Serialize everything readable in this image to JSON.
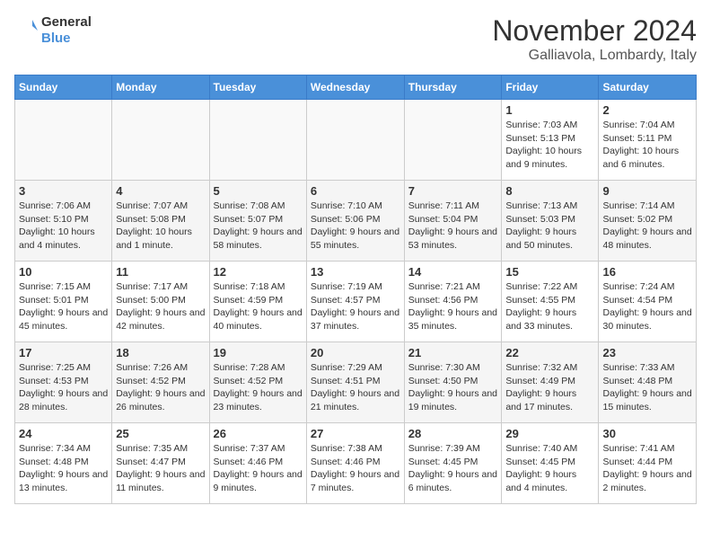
{
  "header": {
    "logo_line1": "General",
    "logo_line2": "Blue",
    "month_year": "November 2024",
    "location": "Galliavola, Lombardy, Italy"
  },
  "weekdays": [
    "Sunday",
    "Monday",
    "Tuesday",
    "Wednesday",
    "Thursday",
    "Friday",
    "Saturday"
  ],
  "weeks": [
    [
      {
        "day": "",
        "info": ""
      },
      {
        "day": "",
        "info": ""
      },
      {
        "day": "",
        "info": ""
      },
      {
        "day": "",
        "info": ""
      },
      {
        "day": "",
        "info": ""
      },
      {
        "day": "1",
        "info": "Sunrise: 7:03 AM\nSunset: 5:13 PM\nDaylight: 10 hours and 9 minutes."
      },
      {
        "day": "2",
        "info": "Sunrise: 7:04 AM\nSunset: 5:11 PM\nDaylight: 10 hours and 6 minutes."
      }
    ],
    [
      {
        "day": "3",
        "info": "Sunrise: 7:06 AM\nSunset: 5:10 PM\nDaylight: 10 hours and 4 minutes."
      },
      {
        "day": "4",
        "info": "Sunrise: 7:07 AM\nSunset: 5:08 PM\nDaylight: 10 hours and 1 minute."
      },
      {
        "day": "5",
        "info": "Sunrise: 7:08 AM\nSunset: 5:07 PM\nDaylight: 9 hours and 58 minutes."
      },
      {
        "day": "6",
        "info": "Sunrise: 7:10 AM\nSunset: 5:06 PM\nDaylight: 9 hours and 55 minutes."
      },
      {
        "day": "7",
        "info": "Sunrise: 7:11 AM\nSunset: 5:04 PM\nDaylight: 9 hours and 53 minutes."
      },
      {
        "day": "8",
        "info": "Sunrise: 7:13 AM\nSunset: 5:03 PM\nDaylight: 9 hours and 50 minutes."
      },
      {
        "day": "9",
        "info": "Sunrise: 7:14 AM\nSunset: 5:02 PM\nDaylight: 9 hours and 48 minutes."
      }
    ],
    [
      {
        "day": "10",
        "info": "Sunrise: 7:15 AM\nSunset: 5:01 PM\nDaylight: 9 hours and 45 minutes."
      },
      {
        "day": "11",
        "info": "Sunrise: 7:17 AM\nSunset: 5:00 PM\nDaylight: 9 hours and 42 minutes."
      },
      {
        "day": "12",
        "info": "Sunrise: 7:18 AM\nSunset: 4:59 PM\nDaylight: 9 hours and 40 minutes."
      },
      {
        "day": "13",
        "info": "Sunrise: 7:19 AM\nSunset: 4:57 PM\nDaylight: 9 hours and 37 minutes."
      },
      {
        "day": "14",
        "info": "Sunrise: 7:21 AM\nSunset: 4:56 PM\nDaylight: 9 hours and 35 minutes."
      },
      {
        "day": "15",
        "info": "Sunrise: 7:22 AM\nSunset: 4:55 PM\nDaylight: 9 hours and 33 minutes."
      },
      {
        "day": "16",
        "info": "Sunrise: 7:24 AM\nSunset: 4:54 PM\nDaylight: 9 hours and 30 minutes."
      }
    ],
    [
      {
        "day": "17",
        "info": "Sunrise: 7:25 AM\nSunset: 4:53 PM\nDaylight: 9 hours and 28 minutes."
      },
      {
        "day": "18",
        "info": "Sunrise: 7:26 AM\nSunset: 4:52 PM\nDaylight: 9 hours and 26 minutes."
      },
      {
        "day": "19",
        "info": "Sunrise: 7:28 AM\nSunset: 4:52 PM\nDaylight: 9 hours and 23 minutes."
      },
      {
        "day": "20",
        "info": "Sunrise: 7:29 AM\nSunset: 4:51 PM\nDaylight: 9 hours and 21 minutes."
      },
      {
        "day": "21",
        "info": "Sunrise: 7:30 AM\nSunset: 4:50 PM\nDaylight: 9 hours and 19 minutes."
      },
      {
        "day": "22",
        "info": "Sunrise: 7:32 AM\nSunset: 4:49 PM\nDaylight: 9 hours and 17 minutes."
      },
      {
        "day": "23",
        "info": "Sunrise: 7:33 AM\nSunset: 4:48 PM\nDaylight: 9 hours and 15 minutes."
      }
    ],
    [
      {
        "day": "24",
        "info": "Sunrise: 7:34 AM\nSunset: 4:48 PM\nDaylight: 9 hours and 13 minutes."
      },
      {
        "day": "25",
        "info": "Sunrise: 7:35 AM\nSunset: 4:47 PM\nDaylight: 9 hours and 11 minutes."
      },
      {
        "day": "26",
        "info": "Sunrise: 7:37 AM\nSunset: 4:46 PM\nDaylight: 9 hours and 9 minutes."
      },
      {
        "day": "27",
        "info": "Sunrise: 7:38 AM\nSunset: 4:46 PM\nDaylight: 9 hours and 7 minutes."
      },
      {
        "day": "28",
        "info": "Sunrise: 7:39 AM\nSunset: 4:45 PM\nDaylight: 9 hours and 6 minutes."
      },
      {
        "day": "29",
        "info": "Sunrise: 7:40 AM\nSunset: 4:45 PM\nDaylight: 9 hours and 4 minutes."
      },
      {
        "day": "30",
        "info": "Sunrise: 7:41 AM\nSunset: 4:44 PM\nDaylight: 9 hours and 2 minutes."
      }
    ]
  ]
}
